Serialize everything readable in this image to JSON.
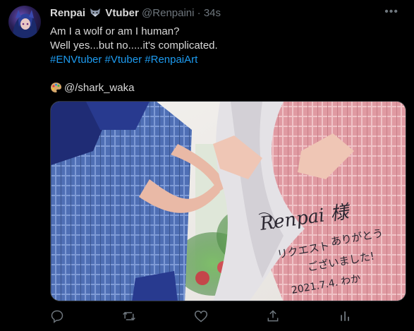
{
  "tweet": {
    "author_name": "Renpai",
    "author_name_suffix": "Vtuber",
    "handle": "@Renpaini",
    "separator": "·",
    "time": "34s",
    "text_line1": "Am I a wolf or am I human?",
    "text_line2": "Well yes...but no.....it's complicated.",
    "hashtags": [
      "#ENVtuber",
      "#Vtuber",
      "#RenpaiArt"
    ],
    "credit": "@/shark_waka",
    "more_label": "•••"
  },
  "media": {
    "handwriting_title": "Renpai 様",
    "handwriting_line2": "リクエスト",
    "handwriting_line3": "ありがとう",
    "handwriting_line4": "ございました!",
    "handwriting_date": "2021.7.4. わか"
  },
  "icons": {
    "reply": "reply-icon",
    "retweet": "retweet-icon",
    "like": "like-icon",
    "share": "share-icon",
    "analytics": "analytics-icon"
  },
  "colors": {
    "background": "#000000",
    "text": "#d9d9d9",
    "muted": "#6e767d",
    "link": "#1d9bf0"
  }
}
